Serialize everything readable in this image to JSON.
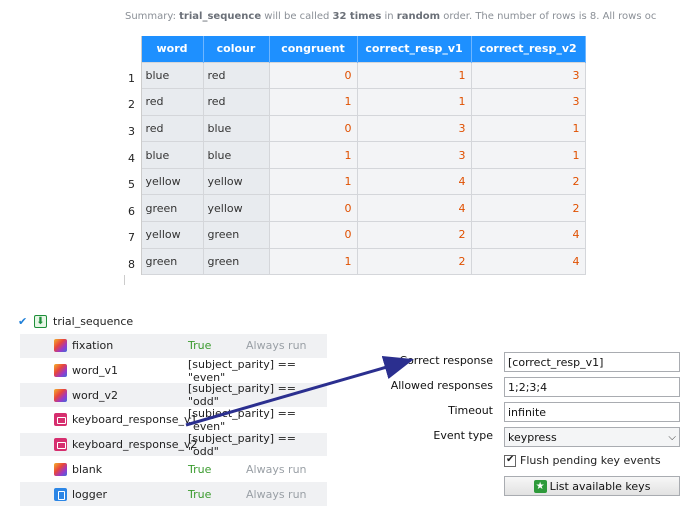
{
  "summary": {
    "prefix": "Summary: ",
    "item": "trial_sequence",
    "mid1": " will be called ",
    "times": "32 times",
    "mid2": " in ",
    "order": "random",
    "suffix": " order. The number of rows is 8. All rows oc"
  },
  "table": {
    "headers": [
      "word",
      "colour",
      "congruent",
      "correct_resp_v1",
      "correct_resp_v2"
    ],
    "rows": [
      {
        "n": "1",
        "word": "blue",
        "colour": "red",
        "congruent": "0",
        "v1": "1",
        "v2": "3"
      },
      {
        "n": "2",
        "word": "red",
        "colour": "red",
        "congruent": "1",
        "v1": "1",
        "v2": "3"
      },
      {
        "n": "3",
        "word": "red",
        "colour": "blue",
        "congruent": "0",
        "v1": "3",
        "v2": "1"
      },
      {
        "n": "4",
        "word": "blue",
        "colour": "blue",
        "congruent": "1",
        "v1": "3",
        "v2": "1"
      },
      {
        "n": "5",
        "word": "yellow",
        "colour": "yellow",
        "congruent": "1",
        "v1": "4",
        "v2": "2"
      },
      {
        "n": "6",
        "word": "green",
        "colour": "yellow",
        "congruent": "0",
        "v1": "4",
        "v2": "2"
      },
      {
        "n": "7",
        "word": "yellow",
        "colour": "green",
        "congruent": "0",
        "v1": "2",
        "v2": "4"
      },
      {
        "n": "8",
        "word": "green",
        "colour": "green",
        "congruent": "1",
        "v1": "2",
        "v2": "4"
      }
    ]
  },
  "sequence": {
    "name": "trial_sequence",
    "items": [
      {
        "name": "fixation",
        "cond": "True",
        "run": "Always run",
        "icon": "sketchpad-icon"
      },
      {
        "name": "word_v1",
        "cond": "[subject_parity] == \"even\"",
        "run": "",
        "icon": "sketchpad-icon"
      },
      {
        "name": "word_v2",
        "cond": "[subject_parity] == \"odd\"",
        "run": "",
        "icon": "sketchpad-icon"
      },
      {
        "name": "keyboard_response_v1",
        "cond": "[subject_parity] == \"even\"",
        "run": "",
        "icon": "keyboard-icon"
      },
      {
        "name": "keyboard_response_v2",
        "cond": "[subject_parity] == \"odd\"",
        "run": "",
        "icon": "keyboard-icon"
      },
      {
        "name": "blank",
        "cond": "True",
        "run": "Always run",
        "icon": "sketchpad-icon"
      },
      {
        "name": "logger",
        "cond": "True",
        "run": "Always run",
        "icon": "logger-icon"
      }
    ]
  },
  "form": {
    "correct_response_label": "Correct response",
    "correct_response_value": "[correct_resp_v1]",
    "allowed_responses_label": "Allowed responses",
    "allowed_responses_value": "1;2;3;4",
    "timeout_label": "Timeout",
    "timeout_value": "infinite",
    "event_type_label": "Event type",
    "event_type_value": "keypress",
    "flush_label": "Flush pending key events",
    "flush_checked": true,
    "list_keys_label": "List available keys"
  },
  "colors": {
    "header_blue": "#1e90ff",
    "number_orange": "#e05000",
    "true_green": "#3a9b2e",
    "arrow_navy": "#2b2f8f"
  }
}
